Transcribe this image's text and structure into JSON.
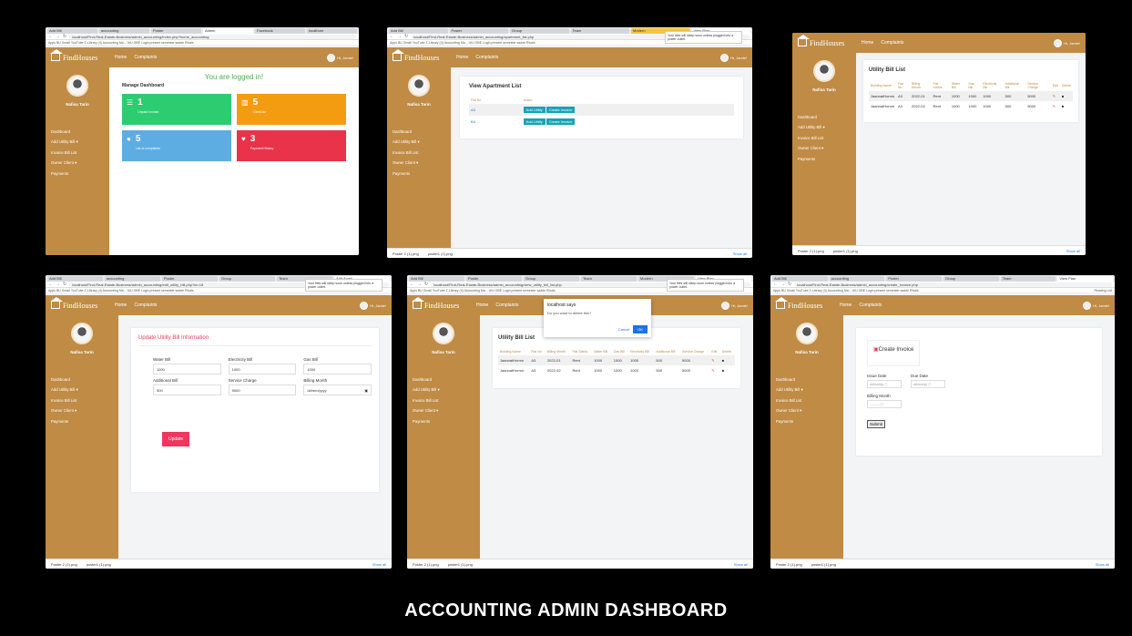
{
  "caption": "ACCOUNTING ADMIN DASHBOARD",
  "app": {
    "brand": "FindHouses",
    "nav_home": "Home",
    "nav_complaints": "Complaints",
    "user_greeting": "Hi, Jamie!",
    "user_name": "Nafisa Tarin",
    "sidebar": [
      "Dashboard",
      "Add Utility Bill ▾",
      "Invoice Bill List",
      "Owner Client ▾",
      "Payments"
    ]
  },
  "browser": {
    "bookmarks": "Apps  BU Gmail  YouTube  Z-Library  (4) Accounting Ma...  UIU OBE Login  present semester  sadde  Rivals",
    "reading_list": "Reading List",
    "download1": "Poster 2 (1).png",
    "download2": "poster1 (1).png",
    "show_all": "Show all",
    "tooltip": "Your files will sleep soon unless plugged into a power outlet."
  },
  "screen1": {
    "logged": "You are logged in!",
    "heading": "Manage Dashboard",
    "tiles": [
      {
        "num": "1",
        "label": "Unpaid Invoice",
        "color": "#2ecc71",
        "icon": "list-icon"
      },
      {
        "num": "5",
        "label": "Client list",
        "color": "#f39c12",
        "icon": "building-icon"
      },
      {
        "num": "5",
        "label": "List of complaints",
        "color": "#5dade2",
        "icon": "chat-icon"
      },
      {
        "num": "3",
        "label": "Payment History",
        "color": "#e8334a",
        "icon": "heart-icon"
      }
    ]
  },
  "screen2": {
    "title": "View Apartment List",
    "col_flat": "Flat No",
    "col_action": "Action",
    "rows": [
      "A3",
      "B4"
    ],
    "btn_add": "Add Utility",
    "btn_invoice": "Create Invoice"
  },
  "bill_table": {
    "title": "Utility Bill List",
    "headers": [
      "Building Name",
      "Flat No",
      "Billing Month",
      "Flat Status",
      "Water Bill",
      "Gas Bill",
      "Electricity Bill",
      "Additional Bill",
      "Service Charge",
      "Edit",
      "Delete"
    ],
    "rows": [
      [
        "JaannatHomm",
        "A3",
        "2022-01",
        "Rent",
        "1000",
        "1000",
        "1000",
        "500",
        "5000"
      ],
      [
        "JaannatHomm",
        "A3",
        "2022-02",
        "Rent",
        "1000",
        "1000",
        "1000",
        "500",
        "5000"
      ]
    ]
  },
  "screen4": {
    "title": "Update Utility Bill Information",
    "fields": [
      {
        "label": "Water Bill",
        "value": "1000"
      },
      {
        "label": "Electricity Bill",
        "value": "1000"
      },
      {
        "label": "Gas Bill",
        "value": "1000"
      },
      {
        "label": "Additional Bill",
        "value": "500"
      },
      {
        "label": "Service Charge",
        "value": "5000"
      },
      {
        "label": "Billing Month",
        "value": "dd/mm/yyyy"
      }
    ],
    "button": "Update"
  },
  "screen5": {
    "dialog_title": "localhost says",
    "dialog_msg": "Do you want to delete this?",
    "cancel": "Cancel",
    "ok": "OK"
  },
  "screen6": {
    "title": "Create Invoice",
    "issue_date": "Issue Date",
    "due_date": "Due Date",
    "billing_month": "Billing Month",
    "date_placeholder": "dd/mm/yy",
    "month_placeholder": "---------",
    "submit": "Submit"
  }
}
